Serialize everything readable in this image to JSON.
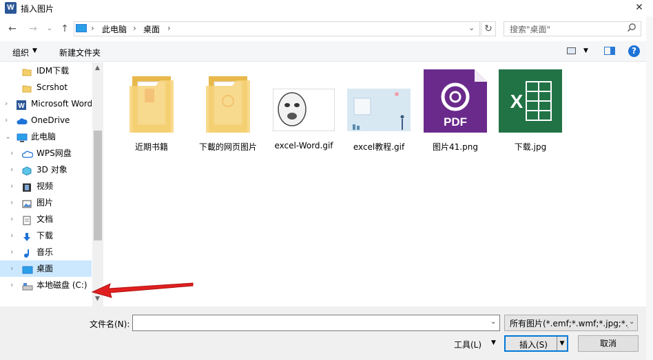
{
  "window": {
    "title": "插入图片",
    "app_icon": "W",
    "close": "✕"
  },
  "nav": {
    "back": "←",
    "forward": "→",
    "recent": "⌄",
    "up": "↑",
    "breadcrumbs": [
      "此电脑",
      "桌面"
    ],
    "separator": "›",
    "refresh": "↻",
    "search_placeholder": "搜索\"桌面\"",
    "search_icon": "⌕"
  },
  "toolbar": {
    "organize": "组织",
    "new_folder": "新建文件夹",
    "help": "?"
  },
  "sidebar": {
    "items": [
      {
        "label": "IDM下载",
        "icon": "folder-icon",
        "expandable": false,
        "indent": 1
      },
      {
        "label": "Scrshot",
        "icon": "folder-icon",
        "expandable": false,
        "indent": 1
      },
      {
        "label": "Microsoft Word",
        "icon": "word-icon",
        "expandable": true,
        "indent": 0
      },
      {
        "label": "OneDrive",
        "icon": "cloud-icon",
        "expandable": true,
        "indent": 0
      },
      {
        "label": "此电脑",
        "icon": "pc-icon",
        "expandable": true,
        "expanded": true,
        "indent": 0
      },
      {
        "label": "WPS网盘",
        "icon": "cloud-outline-icon",
        "expandable": true,
        "indent": 1
      },
      {
        "label": "3D 对象",
        "icon": "cube-icon",
        "expandable": true,
        "indent": 1
      },
      {
        "label": "视频",
        "icon": "video-icon",
        "expandable": true,
        "indent": 1
      },
      {
        "label": "图片",
        "icon": "picture-icon",
        "expandable": true,
        "indent": 1
      },
      {
        "label": "文档",
        "icon": "document-icon",
        "expandable": true,
        "indent": 1
      },
      {
        "label": "下载",
        "icon": "download-icon",
        "expandable": true,
        "indent": 1
      },
      {
        "label": "音乐",
        "icon": "music-icon",
        "expandable": true,
        "indent": 1
      },
      {
        "label": "桌面",
        "icon": "desktop-icon",
        "expandable": true,
        "indent": 1,
        "selected": true
      },
      {
        "label": "本地磁盘 (C:)",
        "icon": "drive-icon",
        "expandable": true,
        "indent": 1
      }
    ]
  },
  "files": [
    {
      "name": "近期书籍",
      "type": "folder"
    },
    {
      "name": "下載的网页图片",
      "type": "folder"
    },
    {
      "name": "excel-Word.gif",
      "type": "image-face"
    },
    {
      "name": "excel教程.gif",
      "type": "image-slide"
    },
    {
      "name": "图片41.png",
      "type": "pdf"
    },
    {
      "name": "下载.jpg",
      "type": "excel"
    }
  ],
  "bottom": {
    "filename_label": "文件名(N):",
    "filename_value": "",
    "filetype": "所有图片(*.emf;*.wmf;*.jpg;*.jr",
    "tools": "工具(L)",
    "insert": "插入(S)",
    "cancel": "取消"
  },
  "colors": {
    "accent": "#0078d7",
    "selected_bg": "#cce8ff",
    "arrow": "#e02020"
  }
}
